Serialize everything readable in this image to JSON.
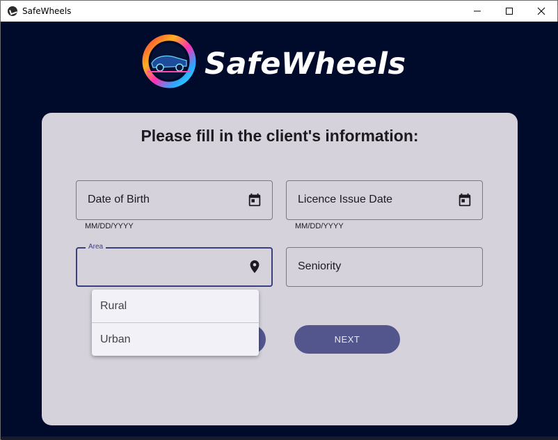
{
  "window": {
    "title": "SafeWheels"
  },
  "brand": {
    "name": "SafeWheels"
  },
  "form": {
    "heading": "Please fill in the client's information:",
    "date_of_birth": {
      "label": "Date of Birth",
      "helper": "MM/DD/YYYY",
      "icon": "calendar-icon"
    },
    "licence_issue_date": {
      "label": "Licence Issue Date",
      "helper": "MM/DD/YYYY",
      "icon": "calendar-icon"
    },
    "area": {
      "label": "Area",
      "value": "",
      "icon": "map-pin-icon",
      "options": [
        "Rural",
        "Urban"
      ]
    },
    "seniority": {
      "label": "Seniority"
    },
    "next_button": "NEXT"
  },
  "colors": {
    "background": "#000a2a",
    "card": "#d5d2dc",
    "accent": "#53568c",
    "focus": "#3b3f7a"
  }
}
